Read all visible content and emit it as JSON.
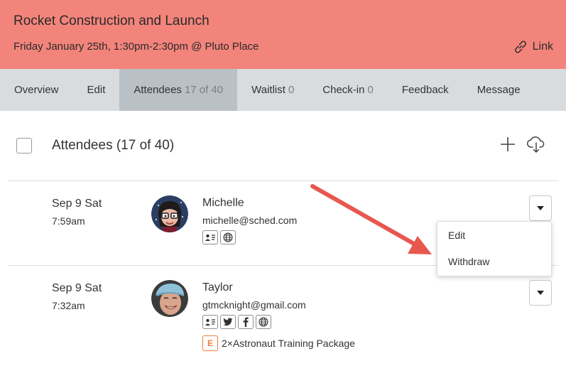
{
  "event": {
    "title": "Rocket Construction and Launch",
    "subtitle": "Friday January 25th, 1:30pm-2:30pm @ Pluto Place",
    "link_label": "Link",
    "link_icon": "link-icon"
  },
  "tabs": [
    {
      "label": "Overview",
      "count": ""
    },
    {
      "label": "Edit",
      "count": ""
    },
    {
      "label": "Attendees",
      "count": "17 of 40",
      "active": true
    },
    {
      "label": "Waitlist",
      "count": "0"
    },
    {
      "label": "Check-in",
      "count": "0"
    },
    {
      "label": "Feedback",
      "count": ""
    },
    {
      "label": "Message",
      "count": ""
    }
  ],
  "list": {
    "title": "Attendees (17 of 40)",
    "add_icon": "plus-icon",
    "download_icon": "cloud-download-icon"
  },
  "attendees": [
    {
      "date": "Sep 9 Sat",
      "time": "7:59am",
      "name": "Michelle",
      "email": "michelle@sched.com",
      "badges": [
        "profile-card-icon",
        "globe-icon"
      ],
      "ticket": ""
    },
    {
      "date": "Sep 9 Sat",
      "time": "7:32am",
      "name": "Taylor",
      "email": "gtmcknight@gmail.com",
      "badges": [
        "profile-card-icon",
        "twitter-icon",
        "facebook-icon",
        "globe-icon"
      ],
      "ticket_badge": "E",
      "ticket": "2×Astronaut Training Package"
    }
  ],
  "row_menu": {
    "items": [
      "Edit",
      "Withdraw"
    ]
  },
  "colors": {
    "header_bg": "#f3847b",
    "tab_bar_bg": "#d8dcdf",
    "active_tab_bg": "#b9c0c6",
    "arrow": "#e8574e",
    "ticket_accent": "#ef7d3a"
  }
}
